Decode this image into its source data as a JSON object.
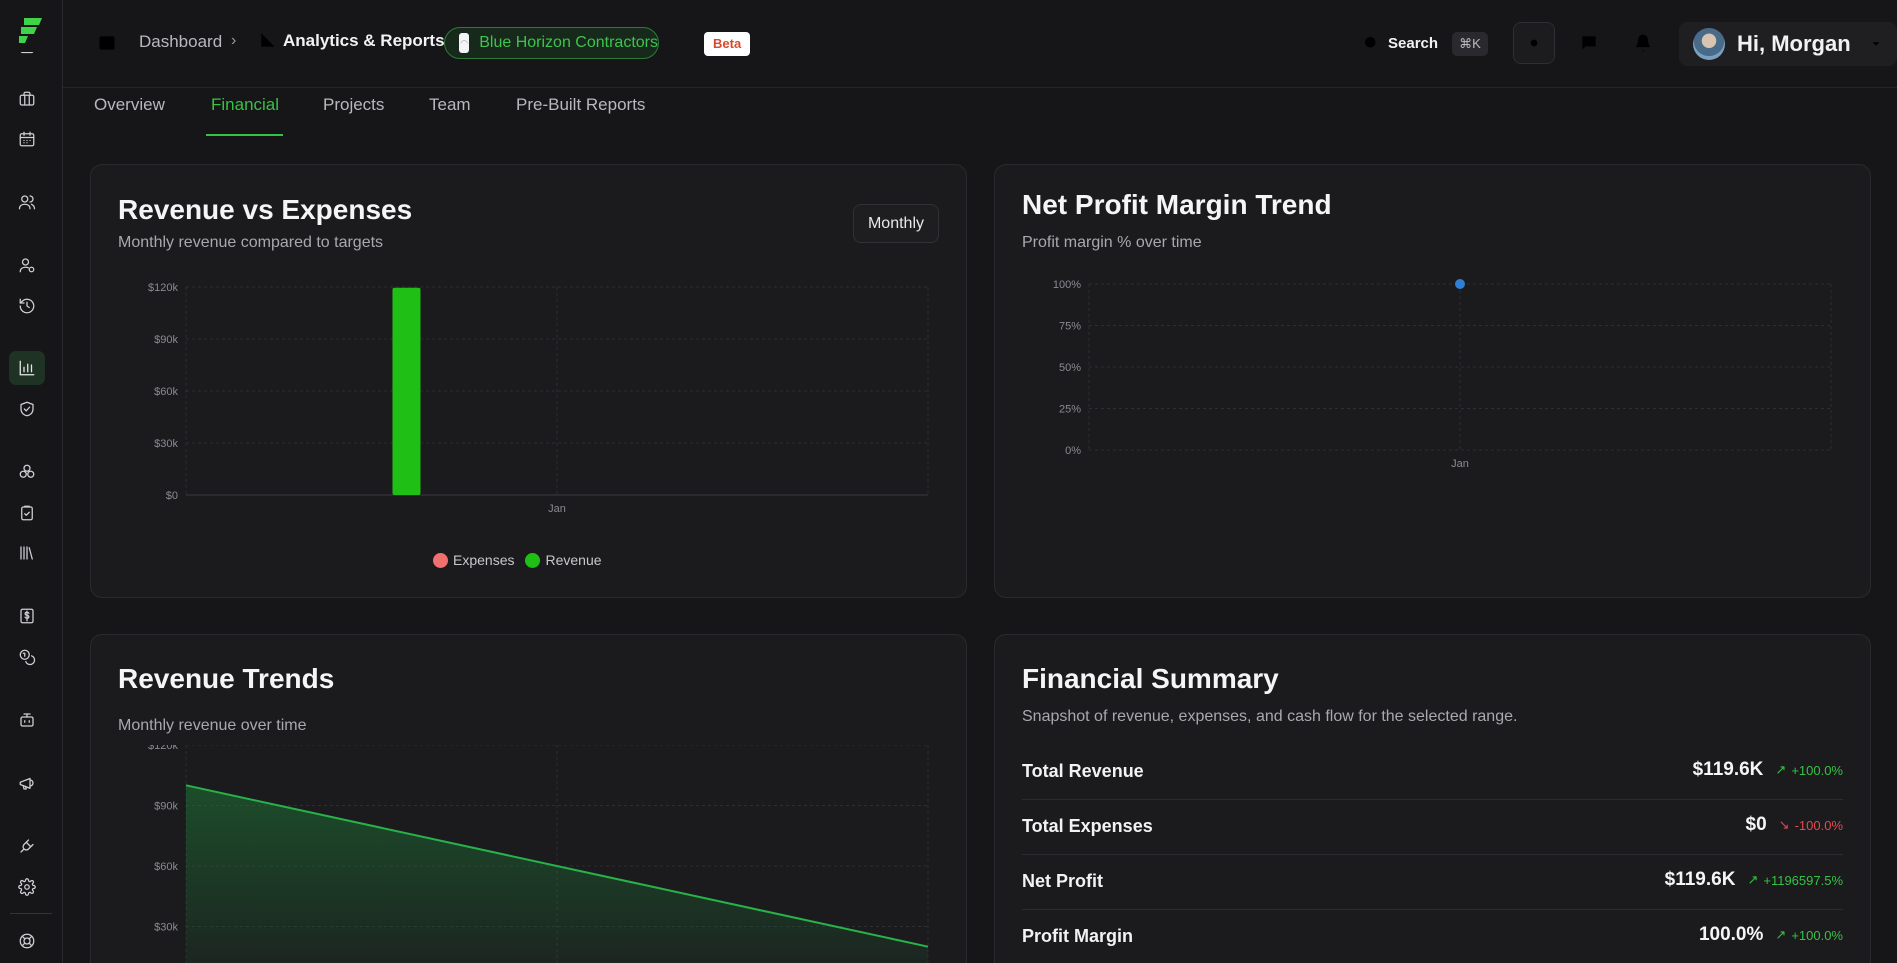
{
  "header": {
    "breadcrumb_root": "Dashboard",
    "breadcrumb_current": "Analytics & Reports",
    "org_name": "Blue Horizon Contractors",
    "beta_badge": "Beta",
    "search_label": "Search",
    "search_shortcut": "⌘K",
    "greeting": "Hi, Morgan"
  },
  "tabs": [
    {
      "label": "Overview"
    },
    {
      "label": "Financial",
      "active": true
    },
    {
      "label": "Projects"
    },
    {
      "label": "Team"
    },
    {
      "label": "Pre-Built Reports"
    }
  ],
  "sidebar": {
    "icons": [
      "app-logo",
      "top-item-icon",
      "briefcase-icon",
      "calendar-icon",
      "users-icon",
      "user-cog-icon",
      "history-icon",
      "bar-chart-icon",
      "shield-check-icon",
      "cubes-icon",
      "clipboard-check-icon",
      "library-icon",
      "dollar-doc-icon",
      "coins-icon",
      "bot-icon",
      "megaphone-icon",
      "plug-icon",
      "gear-icon",
      "help-circle-icon"
    ],
    "active": "bar-chart-icon"
  },
  "revenue_vs_expenses": {
    "title": "Revenue vs Expenses",
    "subtitle": "Monthly revenue compared to targets",
    "period_button": "Monthly",
    "legend": [
      {
        "name": "Expenses",
        "color": "#f07070"
      },
      {
        "name": "Revenue",
        "color": "#1fbf16"
      }
    ]
  },
  "net_profit_margin": {
    "title": "Net Profit Margin Trend",
    "subtitle": "Profit margin % over time"
  },
  "revenue_trends": {
    "title": "Revenue Trends",
    "subtitle": "Monthly revenue over time"
  },
  "financial_summary": {
    "title": "Financial Summary",
    "subtitle": "Snapshot of revenue, expenses, and cash flow for the selected range.",
    "rows": [
      {
        "label": "Total Revenue",
        "value": "$119.6K",
        "change": "+100.0%",
        "direction": "up"
      },
      {
        "label": "Total Expenses",
        "value": "$0",
        "change": "-100.0%",
        "direction": "down"
      },
      {
        "label": "Net Profit",
        "value": "$119.6K",
        "change": "+1196597.5%",
        "direction": "up"
      },
      {
        "label": "Profit Margin",
        "value": "100.0%",
        "change": "+100.0%",
        "direction": "up"
      }
    ]
  },
  "colors": {
    "accent": "#35c244",
    "revenue": "#1fbf16",
    "expenses": "#f07070",
    "margin_point": "#2f7fd6",
    "up": "#35c244",
    "down": "#e5484d"
  },
  "chart_data": [
    {
      "type": "bar",
      "title": "Revenue vs Expenses",
      "categories": [
        "Jan"
      ],
      "series": [
        {
          "name": "Expenses",
          "values": [
            0
          ]
        },
        {
          "name": "Revenue",
          "values": [
            119600
          ]
        }
      ],
      "y_ticks": [
        "$0",
        "$30k",
        "$60k",
        "$90k",
        "$120k"
      ],
      "ylim": [
        0,
        120000
      ],
      "grid": true,
      "legend_position": "bottom"
    },
    {
      "type": "line",
      "title": "Net Profit Margin Trend",
      "categories": [
        "Jan"
      ],
      "series": [
        {
          "values": [
            100
          ]
        }
      ],
      "y_ticks": [
        "0%",
        "25%",
        "50%",
        "75%",
        "100%"
      ],
      "ylim": [
        0,
        100
      ],
      "grid": true
    },
    {
      "type": "area",
      "title": "Revenue Trends",
      "y_ticks": [
        "$30k",
        "$60k",
        "$90k",
        "$120k"
      ],
      "ylim": [
        0,
        120000
      ],
      "series": [
        {
          "values": [
            100000,
            20000
          ]
        }
      ],
      "grid": true
    }
  ]
}
